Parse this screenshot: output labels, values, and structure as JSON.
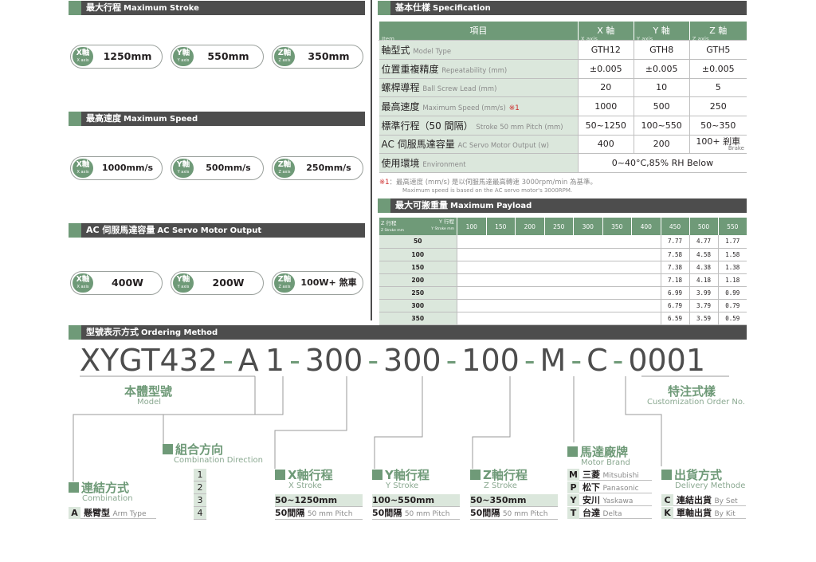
{
  "stroke": {
    "title_zh": "最大行程",
    "title_en": "Maximum Stroke",
    "items": [
      {
        "axis": "X軸",
        "axis_en": "X axis",
        "value": "1250mm"
      },
      {
        "axis": "Y軸",
        "axis_en": "Y axis",
        "value": "550mm"
      },
      {
        "axis": "Z軸",
        "axis_en": "Z axis",
        "value": "350mm"
      }
    ]
  },
  "speed": {
    "title_zh": "最高速度",
    "title_en": "Maximum Speed",
    "items": [
      {
        "axis": "X軸",
        "axis_en": "X axis",
        "value": "1000mm/s"
      },
      {
        "axis": "Y軸",
        "axis_en": "Y axis",
        "value": "500mm/s"
      },
      {
        "axis": "Z軸",
        "axis_en": "Z axis",
        "value": "250mm/s"
      }
    ]
  },
  "motor": {
    "title_zh": "AC 伺服馬達容量",
    "title_en": "AC Servo Motor Output",
    "items": [
      {
        "axis": "X軸",
        "axis_en": "X axis",
        "value": "400W"
      },
      {
        "axis": "Y軸",
        "axis_en": "Y axis",
        "value": "200W"
      },
      {
        "axis": "Z軸",
        "axis_en": "Z axis",
        "value": "100W+ 煞車"
      }
    ]
  },
  "spec": {
    "title_zh": "基本仕樣",
    "title_en": "Specification",
    "header": {
      "item_zh": "項目",
      "item_en": "Item",
      "x_zh": "X 軸",
      "x_en": "X axis",
      "y_zh": "Y 軸",
      "y_en": "Y axis",
      "z_zh": "Z 軸",
      "z_en": "Z axis"
    },
    "rows": [
      {
        "zh": "軸型式",
        "en": "Model Type",
        "mark": "",
        "x": "GTH12",
        "y": "GTH8",
        "z": "GTH5"
      },
      {
        "zh": "位置重複精度",
        "en": "Repeatability (mm)",
        "mark": "",
        "x": "±0.005",
        "y": "±0.005",
        "z": "±0.005"
      },
      {
        "zh": "螺桿導程",
        "en": "Ball Screw Lead (mm)",
        "mark": "",
        "x": "20",
        "y": "10",
        "z": "5"
      },
      {
        "zh": "最高速度",
        "en": "Maximum Speed (mm/s)",
        "mark": "※1",
        "x": "1000",
        "y": "500",
        "z": "250"
      },
      {
        "zh": "標準行程（50 間隔）",
        "en": "Stroke 50 mm Pitch (mm)",
        "mark": "",
        "x": "50~1250",
        "y": "100~550",
        "z": "50~350"
      },
      {
        "zh": "AC 伺服馬達容量",
        "en": "AC Servo Motor Output (w)",
        "mark": "",
        "x": "400",
        "y": "200",
        "z": "100+ 剎車",
        "z_sub": "Brake"
      }
    ],
    "env": {
      "zh": "使用環境",
      "en": "Environment",
      "value": "0~40°C,85% RH Below"
    },
    "note_mark": "※1",
    "note_zh": "：最高速度 (mm/s) 是以伺服馬達最高轉速 3000rpm/min 為基準。",
    "note_en": "Maximum speed is based on the AC servo motor's 3000RPM."
  },
  "payload": {
    "title_zh": "最大可搬重量",
    "title_en": "Maximum Payload",
    "y_label_zh": "Y 行程",
    "y_label_en": "Y Stroke mm",
    "z_label_zh": "Z 行程",
    "z_label_en": "Z Stroke mm",
    "columns": [
      "100",
      "150",
      "200",
      "250",
      "300",
      "350",
      "400",
      "450",
      "500",
      "550"
    ],
    "rows": [
      {
        "z": "50",
        "values": [
          "",
          "",
          "",
          "",
          "",
          "",
          "",
          "7.77",
          "4.77",
          "1.77"
        ]
      },
      {
        "z": "100",
        "values": [
          "",
          "",
          "",
          "",
          "",
          "",
          "",
          "7.58",
          "4.58",
          "1.58"
        ]
      },
      {
        "z": "150",
        "values": [
          "",
          "",
          "",
          "",
          "",
          "",
          "",
          "7.38",
          "4.38",
          "1.38"
        ]
      },
      {
        "z": "200",
        "values": [
          "",
          "",
          "",
          "",
          "",
          "",
          "",
          "7.18",
          "4.18",
          "1.18"
        ]
      },
      {
        "z": "250",
        "values": [
          "",
          "",
          "",
          "",
          "",
          "",
          "",
          "6.99",
          "3.99",
          "0.99"
        ]
      },
      {
        "z": "300",
        "values": [
          "",
          "",
          "",
          "",
          "",
          "",
          "",
          "6.79",
          "3.79",
          "0.79"
        ]
      },
      {
        "z": "350",
        "values": [
          "",
          "",
          "",
          "",
          "",
          "",
          "",
          "6.59",
          "3.59",
          "0.59"
        ]
      }
    ]
  },
  "ordering": {
    "title_zh": "型號表示方式",
    "title_en": "Ordering Method",
    "code_parts": [
      "XYGT432",
      "A",
      "1",
      "300",
      "300",
      "100",
      "M",
      "C",
      "0001"
    ],
    "separator": "-",
    "model_zh": "本體型號",
    "model_en": "Model",
    "custom_zh": "特注式樣",
    "custom_en": "Customization Order No.",
    "combination": {
      "zh": "連結方式",
      "en": "Combination",
      "options": [
        {
          "key": "A",
          "zh": "懸臂型",
          "en": "Arm Type"
        }
      ]
    },
    "direction": {
      "zh": "組合方向",
      "en": "Combination Direction",
      "options": [
        "1",
        "2",
        "3",
        "4"
      ]
    },
    "x_stroke": {
      "zh": "X軸行程",
      "en": "X Stroke",
      "range": "50~1250mm",
      "pitch_zh": "50間隔",
      "pitch_en": "50 mm Pitch"
    },
    "y_stroke": {
      "zh": "Y軸行程",
      "en": "Y Stroke",
      "range": "100~550mm",
      "pitch_zh": "50間隔",
      "pitch_en": "50 mm Pitch"
    },
    "z_stroke": {
      "zh": "Z軸行程",
      "en": "Z Stroke",
      "range": "50~350mm",
      "pitch_zh": "50間隔",
      "pitch_en": "50 mm Pitch"
    },
    "motor_brand": {
      "zh": "馬達廠牌",
      "en": "Motor Brand",
      "options": [
        {
          "key": "M",
          "zh": "三菱",
          "en": "Mitsubishi"
        },
        {
          "key": "P",
          "zh": "松下",
          "en": "Panasonic"
        },
        {
          "key": "Y",
          "zh": "安川",
          "en": "Yaskawa"
        },
        {
          "key": "T",
          "zh": "台達",
          "en": "Delta"
        }
      ]
    },
    "delivery": {
      "zh": "出貨方式",
      "en": "Delivery Methode",
      "options": [
        {
          "key": "C",
          "zh": "連結出貨",
          "en": "By Set"
        },
        {
          "key": "K",
          "zh": "單軸出貨",
          "en": "By Kit"
        }
      ]
    }
  },
  "colors": {
    "accent": "#6f9a78",
    "bar": "#4d4d4d",
    "light": "#dbe7dc"
  }
}
